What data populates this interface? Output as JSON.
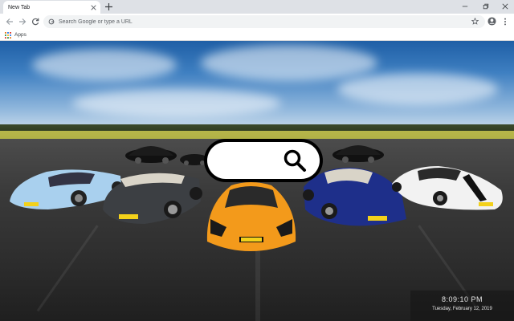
{
  "tab": {
    "title": "New Tab"
  },
  "toolbar": {
    "omnibox_placeholder": "Search Google or type a URL"
  },
  "bookmarks": {
    "apps_label": "Apps"
  },
  "clock": {
    "time": "8:09:10 PM",
    "date": "Tuesday, February 12, 2019"
  },
  "colors": {
    "tab_strip": "#dee1e6",
    "omnibox": "#f1f3f4",
    "car_orange": "#f39a1b",
    "car_blue": "#1e2f8a",
    "car_lightblue": "#a9d0ee"
  }
}
